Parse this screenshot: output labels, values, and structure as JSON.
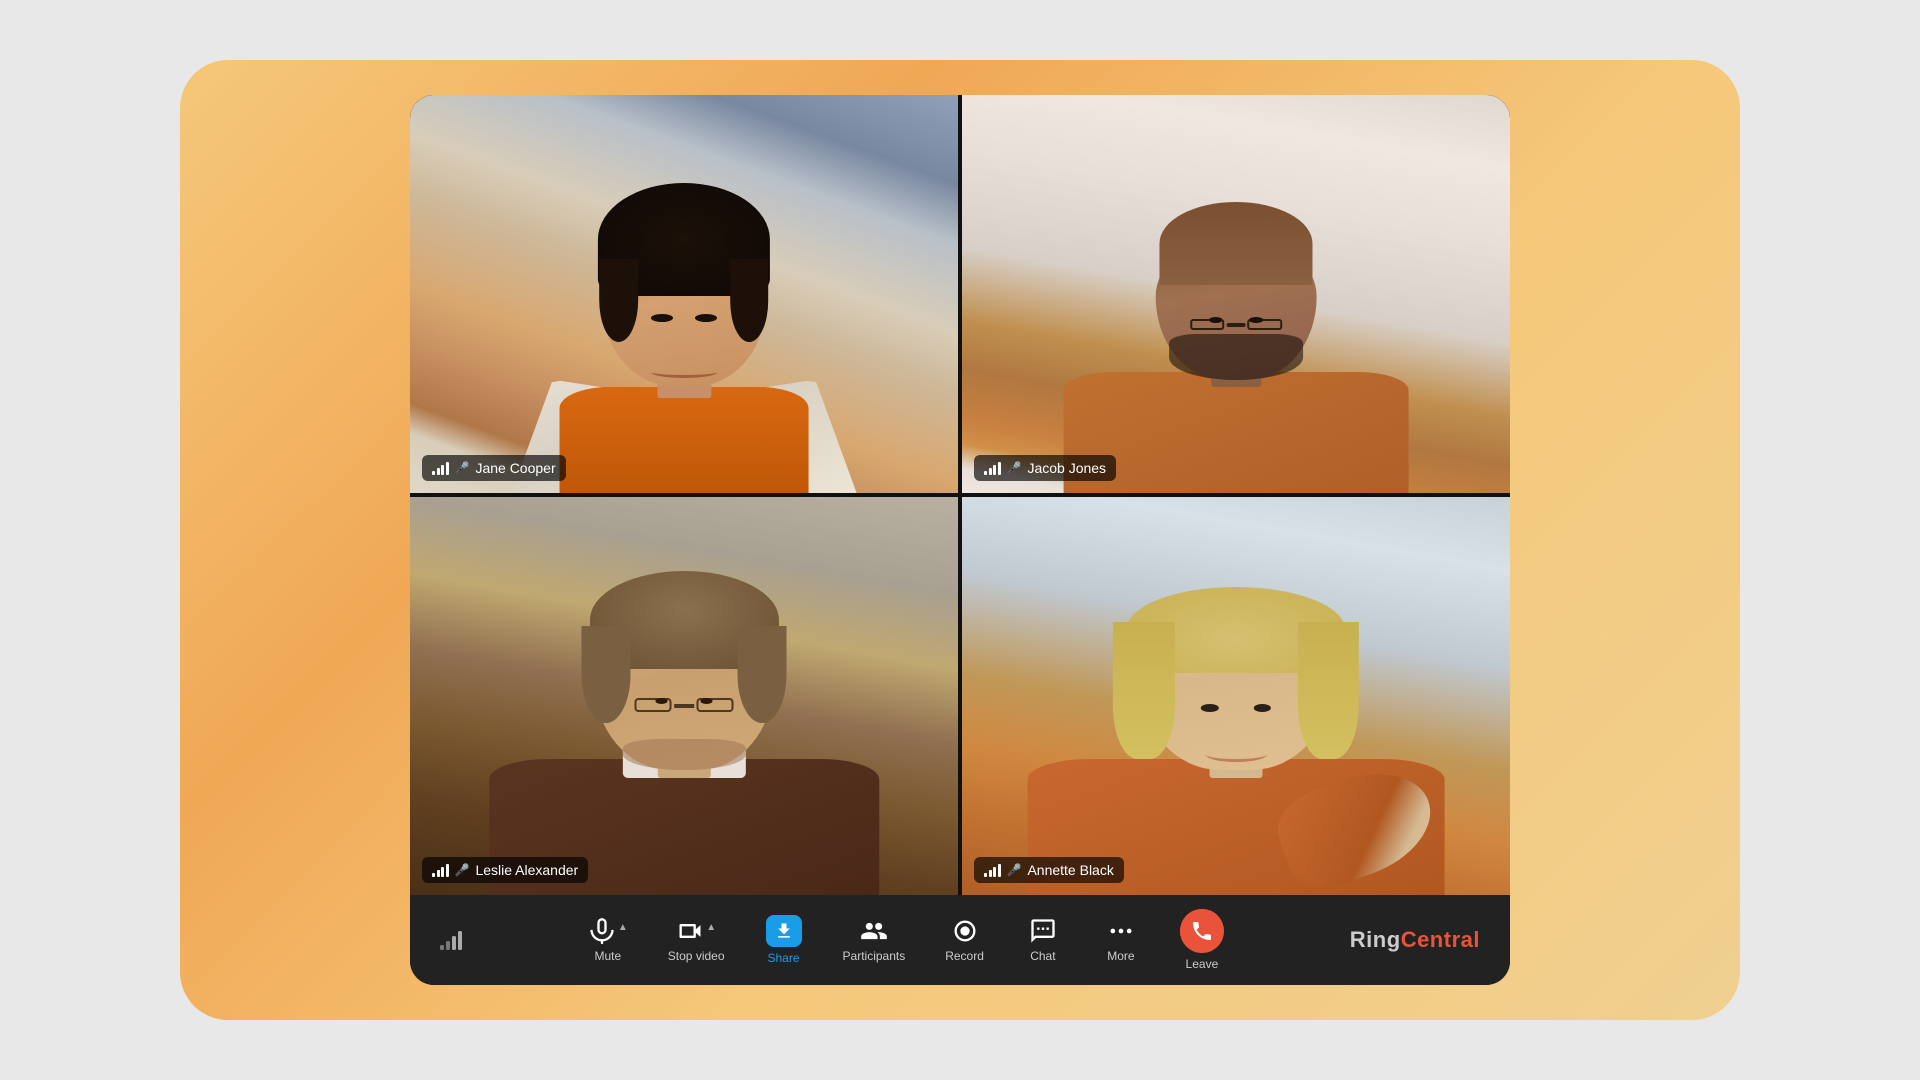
{
  "app": {
    "brand": "RingCentral",
    "brand_color": "#e8533a"
  },
  "participants": [
    {
      "id": "jane",
      "name": "Jane Cooper",
      "signal": 3,
      "mic": true,
      "position": "top-left"
    },
    {
      "id": "jacob",
      "name": "Jacob Jones",
      "signal": 3,
      "mic": true,
      "position": "top-right"
    },
    {
      "id": "leslie",
      "name": "Leslie Alexander",
      "signal": 3,
      "mic": true,
      "position": "bottom-left"
    },
    {
      "id": "annette",
      "name": "Annette Black",
      "signal": 3,
      "mic": true,
      "position": "bottom-right"
    }
  ],
  "toolbar": {
    "mute_label": "Mute",
    "stop_video_label": "Stop video",
    "share_label": "Share",
    "participants_label": "Participants",
    "record_label": "Record",
    "chat_label": "Chat",
    "more_label": "More",
    "leave_label": "Leave"
  },
  "colors": {
    "bg_outer": "#e8e8e8",
    "gradient_start": "#f5c87a",
    "gradient_end": "#f0a855",
    "app_bg": "#1a1a1a",
    "toolbar_bg": "#222222",
    "share_active": "#1a9de8",
    "leave_color": "#e8533a",
    "label_bg": "rgba(0,0,0,0.65)"
  }
}
